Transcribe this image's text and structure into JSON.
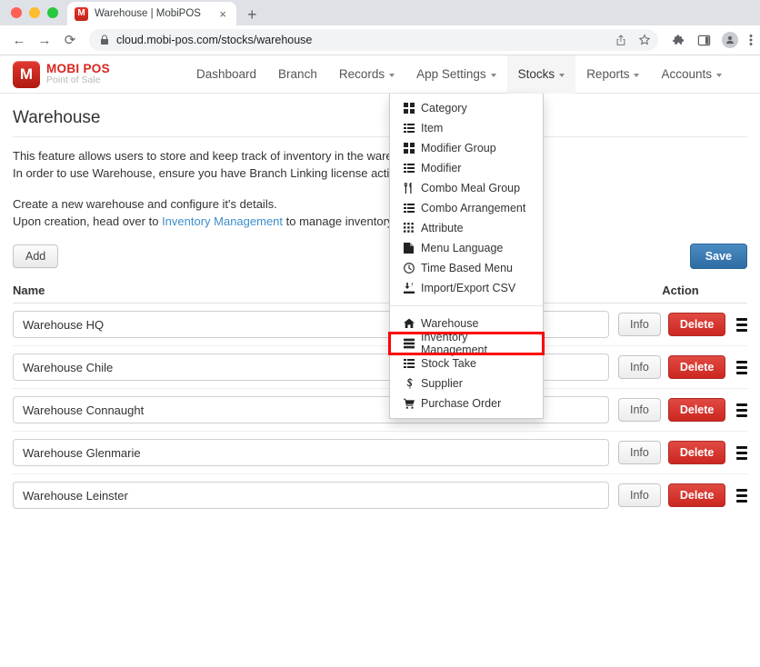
{
  "browser": {
    "tab": {
      "title": "Warehouse | MobiPOS",
      "favicon_letter": "M",
      "close_label": "×"
    },
    "new_tab_label": "+",
    "nav": {
      "back": "←",
      "forward": "→",
      "reload": "⟳"
    },
    "omnibox": {
      "lock": "🔒",
      "url": "cloud.mobi-pos.com/stocks/warehouse"
    },
    "icons": {
      "share": "share-icon",
      "bookmark": "star-icon",
      "extensions": "puzzle-icon",
      "side_panel": "side-panel-icon",
      "profile": "avatar-icon",
      "menu": "kebab-menu-icon"
    }
  },
  "app": {
    "logo": {
      "title": "MOBI POS",
      "subtitle": "Point of Sale",
      "mark_letter": "M"
    },
    "nav_items": [
      {
        "label": "Dashboard",
        "has_caret": false,
        "active": false
      },
      {
        "label": "Branch",
        "has_caret": false,
        "active": false
      },
      {
        "label": "Records",
        "has_caret": true,
        "active": false
      },
      {
        "label": "App Settings",
        "has_caret": true,
        "active": false
      },
      {
        "label": "Stocks",
        "has_caret": true,
        "active": true
      },
      {
        "label": "Reports",
        "has_caret": true,
        "active": false
      },
      {
        "label": "Accounts",
        "has_caret": true,
        "active": false
      }
    ],
    "dropdown": {
      "open_for": "Stocks",
      "groups": [
        {
          "items": [
            {
              "label": "Category",
              "icon": "grid-squares-icon",
              "glyph": "▦",
              "highlighted": false
            },
            {
              "label": "Item",
              "icon": "list-icon",
              "glyph": "☰",
              "highlighted": false
            },
            {
              "label": "Modifier Group",
              "icon": "grid-squares-icon",
              "glyph": "▦",
              "highlighted": false
            },
            {
              "label": "Modifier",
              "icon": "list-icon",
              "glyph": "☰",
              "highlighted": false
            },
            {
              "label": "Combo Meal Group",
              "icon": "cutlery-icon",
              "glyph": "🍴",
              "highlighted": false
            },
            {
              "label": "Combo Arrangement",
              "icon": "list-icon",
              "glyph": "☰",
              "highlighted": false
            },
            {
              "label": "Attribute",
              "icon": "dots-grid-icon",
              "glyph": "∷",
              "highlighted": false
            },
            {
              "label": "Menu Language",
              "icon": "file-icon",
              "glyph": "🗋",
              "highlighted": false
            },
            {
              "label": "Time Based Menu",
              "icon": "clock-icon",
              "glyph": "◴",
              "highlighted": false
            },
            {
              "label": "Import/Export CSV",
              "icon": "import-export-icon",
              "glyph": "↥",
              "highlighted": false
            }
          ]
        },
        {
          "items": [
            {
              "label": "Warehouse",
              "icon": "home-icon",
              "glyph": "⌂",
              "highlighted": false
            },
            {
              "label": "Inventory Management",
              "icon": "inventory-icon",
              "glyph": "☰",
              "highlighted": true
            },
            {
              "label": "Stock Take",
              "icon": "list-icon",
              "glyph": "☰",
              "highlighted": false
            },
            {
              "label": "Supplier",
              "icon": "supplier-icon",
              "glyph": "℘",
              "highlighted": false
            },
            {
              "label": "Purchase Order",
              "icon": "cart-icon",
              "glyph": "🛒",
              "highlighted": false
            }
          ]
        }
      ]
    },
    "page": {
      "title": "Warehouse",
      "paragraph1_line1": "This feature allows users to store and keep track of inventory in the warehouse.",
      "paragraph1_line2": "In order to use Warehouse, ensure you have Branch Linking license activated.",
      "paragraph2_line1": "Create a new warehouse and configure it's details.",
      "paragraph2_prefix": "Upon creation, head over to ",
      "paragraph2_link": "Inventory Management",
      "paragraph2_suffix": " to manage inventory of your"
    },
    "toolbar": {
      "add_label": "Add",
      "save_label": "Save"
    },
    "table": {
      "header_name": "Name",
      "header_action": "Action",
      "info_label": "Info",
      "delete_label": "Delete",
      "rows": [
        {
          "name": "Warehouse HQ"
        },
        {
          "name": "Warehouse Chile"
        },
        {
          "name": "Warehouse Connaught"
        },
        {
          "name": "Warehouse Glenmarie"
        },
        {
          "name": "Warehouse Leinster"
        }
      ]
    },
    "colors": {
      "brand_red": "#d9251d",
      "primary_blue": "#2e6da4",
      "danger_red": "#cc2620",
      "link_blue": "#3d8ecc",
      "highlight_red": "#ff0000"
    }
  }
}
